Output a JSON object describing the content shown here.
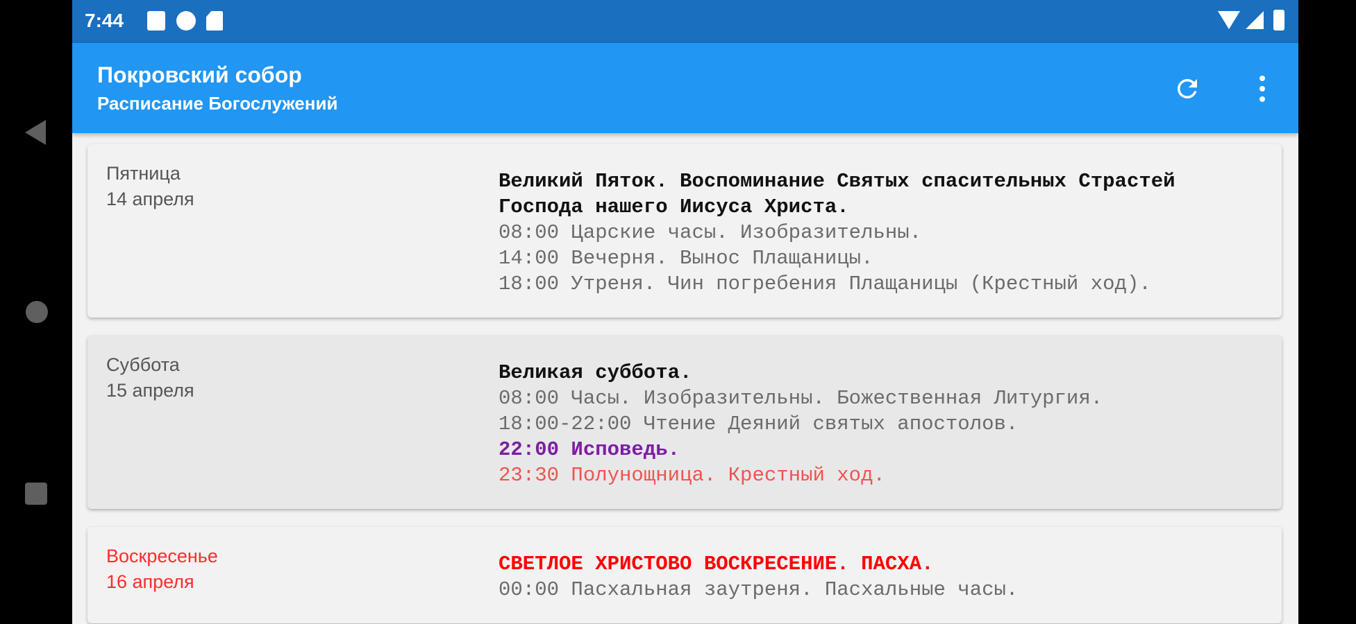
{
  "status_bar": {
    "time": "7:44"
  },
  "toolbar": {
    "title": "Покровский собор",
    "subtitle": "Расписание Богослужений",
    "refresh_icon": "refresh-icon",
    "menu_icon": "more-vert-icon"
  },
  "colors": {
    "toolbar": "#2196f3",
    "status_bar": "#1a6fbf",
    "sunday": "#ff2b2b",
    "confession": "#7b1fa2",
    "procession": "#ef5350"
  },
  "cards": [
    {
      "weekday": "Пятница",
      "date": "14 апреля",
      "title_lines": [
        "Великий Пяток. Воспоминание Святых спасительных Страстей",
        "Господа нашего Иисуса Христа."
      ],
      "lines": [
        "08:00 Царские часы. Изобразительны.",
        "14:00 Вечерня. Вынос Плащаницы.",
        "18:00 Утреня. Чин погребения Плащаницы (Крестный ход)."
      ]
    },
    {
      "weekday": "Суббота",
      "date": "15 апреля",
      "title_lines": [
        "Великая суббота."
      ],
      "lines": [
        "08:00 Часы. Изобразительны. Божественная Литургия.",
        "18:00-22:00 Чтение Деяний святых апостолов.",
        "22:00 Исповедь.",
        "23:30 Полунощница. Крестный ход."
      ]
    },
    {
      "weekday": "Воскресенье",
      "date": "16 апреля",
      "title_lines": [
        "СВЕТЛОЕ ХРИСТОВО ВОСКРЕСЕНИЕ. ПАСХА."
      ],
      "lines": [
        "00:00 Пасхальная заутреня. Пасхальные часы."
      ]
    }
  ]
}
